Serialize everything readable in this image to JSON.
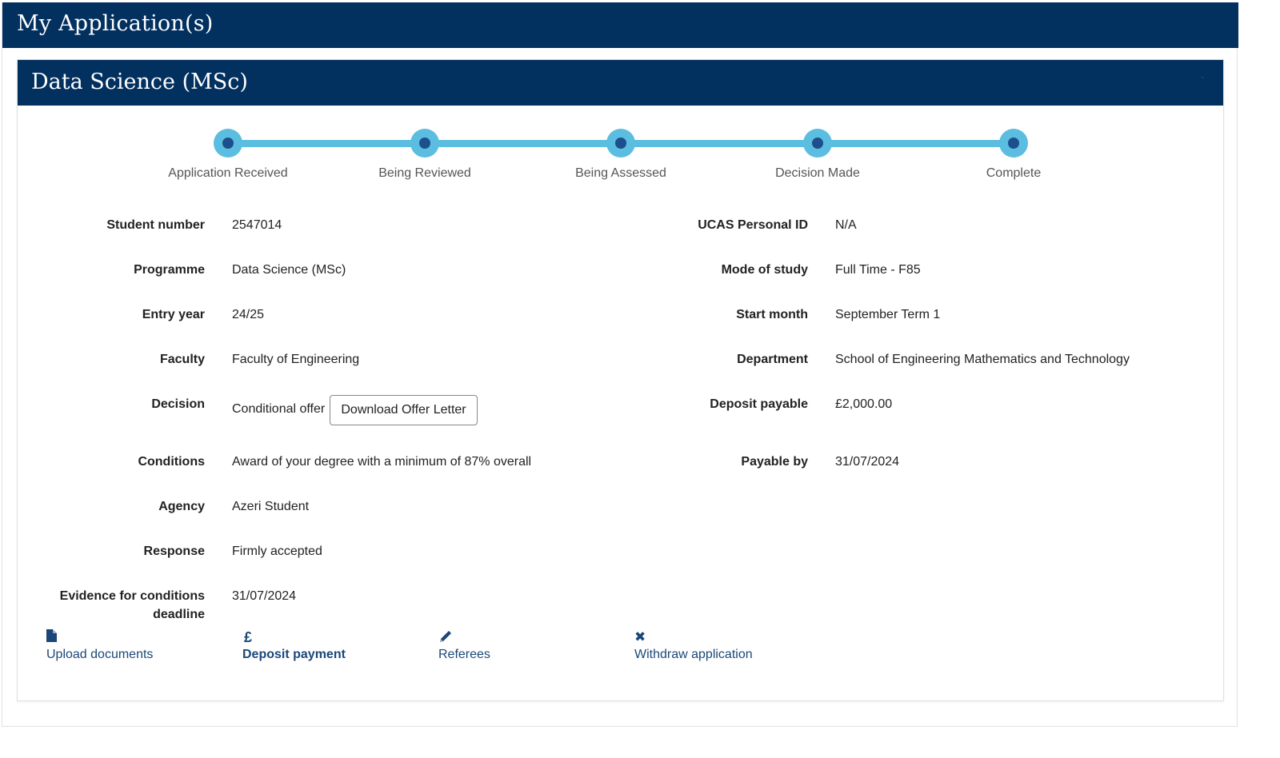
{
  "page": {
    "title": "My Application(s)"
  },
  "application": {
    "title": "Data Science (MSc)",
    "steps": [
      "Application Received",
      "Being Reviewed",
      "Being Assessed",
      "Decision Made",
      "Complete"
    ],
    "left_fields": [
      {
        "label": "Student number",
        "value": "2547014"
      },
      {
        "label": "Programme",
        "value": "Data Science (MSc)"
      },
      {
        "label": "Entry year",
        "value": "24/25"
      },
      {
        "label": "Faculty",
        "value": "Faculty of Engineering"
      },
      {
        "label": "Decision",
        "value": "Conditional offer"
      },
      {
        "label": "Conditions",
        "value": "Award of your degree with a minimum of 87% overall"
      },
      {
        "label": "Agency",
        "value": "Azeri Student"
      },
      {
        "label": "Response",
        "value": "Firmly accepted"
      },
      {
        "label": "Evidence for conditions deadline",
        "value": "31/07/2024"
      }
    ],
    "right_fields": [
      {
        "label": "UCAS Personal ID",
        "value": "N/A"
      },
      {
        "label": "Mode of study",
        "value": "Full Time - F85"
      },
      {
        "label": "Start month",
        "value": "September Term 1"
      },
      {
        "label": "Department",
        "value": "School of Engineering Mathematics and Technology"
      },
      {
        "label": "Deposit payable",
        "value": "£2,000.00"
      },
      {
        "label": "Payable by",
        "value": "31/07/2024"
      }
    ],
    "download_button": "Download Offer Letter",
    "actions": [
      {
        "label": "Upload documents",
        "icon": "file-icon"
      },
      {
        "label": "Deposit payment",
        "icon": "pound-icon",
        "glyph": "£"
      },
      {
        "label": "Referees",
        "icon": "pencil-icon"
      },
      {
        "label": "Withdraw application",
        "icon": "close-icon",
        "glyph": "✖"
      }
    ]
  },
  "colors": {
    "header": "#02305f",
    "accent": "#5bbde0",
    "step_dot": "#1d4f8c",
    "link": "#1b4778"
  }
}
